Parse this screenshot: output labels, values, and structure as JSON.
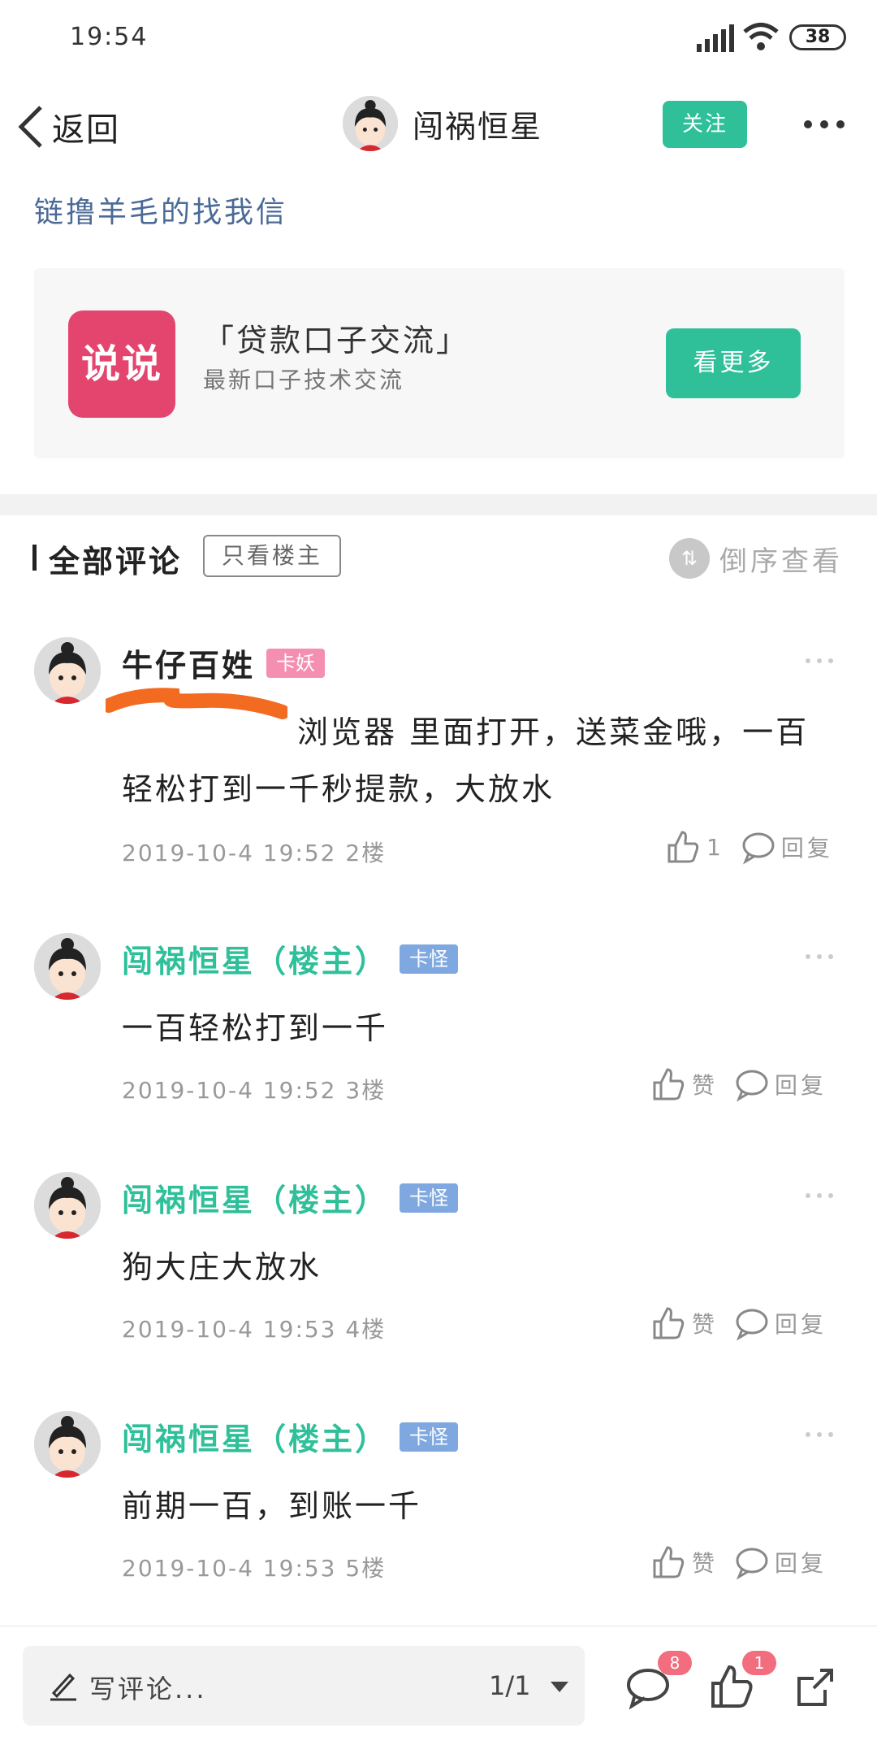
{
  "status_bar": {
    "time": "19:54",
    "battery": "38"
  },
  "nav": {
    "back_label": "返回",
    "title": "闯祸恒星",
    "follow_label": "关注"
  },
  "post": {
    "title": "链撸羊毛的找我信"
  },
  "promo": {
    "logo_text": "说说",
    "title": "「贷款口子交流」",
    "subtitle": "最新口子技术交流",
    "button_label": "看更多"
  },
  "comments_section": {
    "title": "全部评论",
    "filter_label": "只看楼主",
    "sort_label": "倒序查看"
  },
  "comments": [
    {
      "name": "牛仔百姓",
      "badge": "卡妖",
      "text_line1": "浏览器 里面打开，送菜金哦，一百",
      "text_line2": "轻松打到一千秒提款，大放水",
      "meta": "2019-10-4 19:52 2楼",
      "like_label": "1",
      "reply_label": "回复"
    },
    {
      "name": "闯祸恒星（楼主）",
      "badge": "卡怪",
      "text_line1": "一百轻松打到一千",
      "meta": "2019-10-4 19:52 3楼",
      "like_label": "赞",
      "reply_label": "回复"
    },
    {
      "name": "闯祸恒星（楼主）",
      "badge": "卡怪",
      "text_line1": "狗大庄大放水",
      "meta": "2019-10-4 19:53 4楼",
      "like_label": "赞",
      "reply_label": "回复"
    },
    {
      "name": "闯祸恒星（楼主）",
      "badge": "卡怪",
      "text_line1": "前期一百，到账一千",
      "meta": "2019-10-4 19:53 5楼",
      "like_label": "赞",
      "reply_label": "回复"
    }
  ],
  "bottom_bar": {
    "write_label": "写评论...",
    "page_indicator": "1/1",
    "comment_badge": "8",
    "like_badge": "1"
  },
  "colors": {
    "accent": "#2fc09a",
    "title_link": "#4b6a97",
    "promo_logo": "#e4456e",
    "badge_pink": "#f48fb1",
    "badge_blue": "#7fa8e0"
  }
}
